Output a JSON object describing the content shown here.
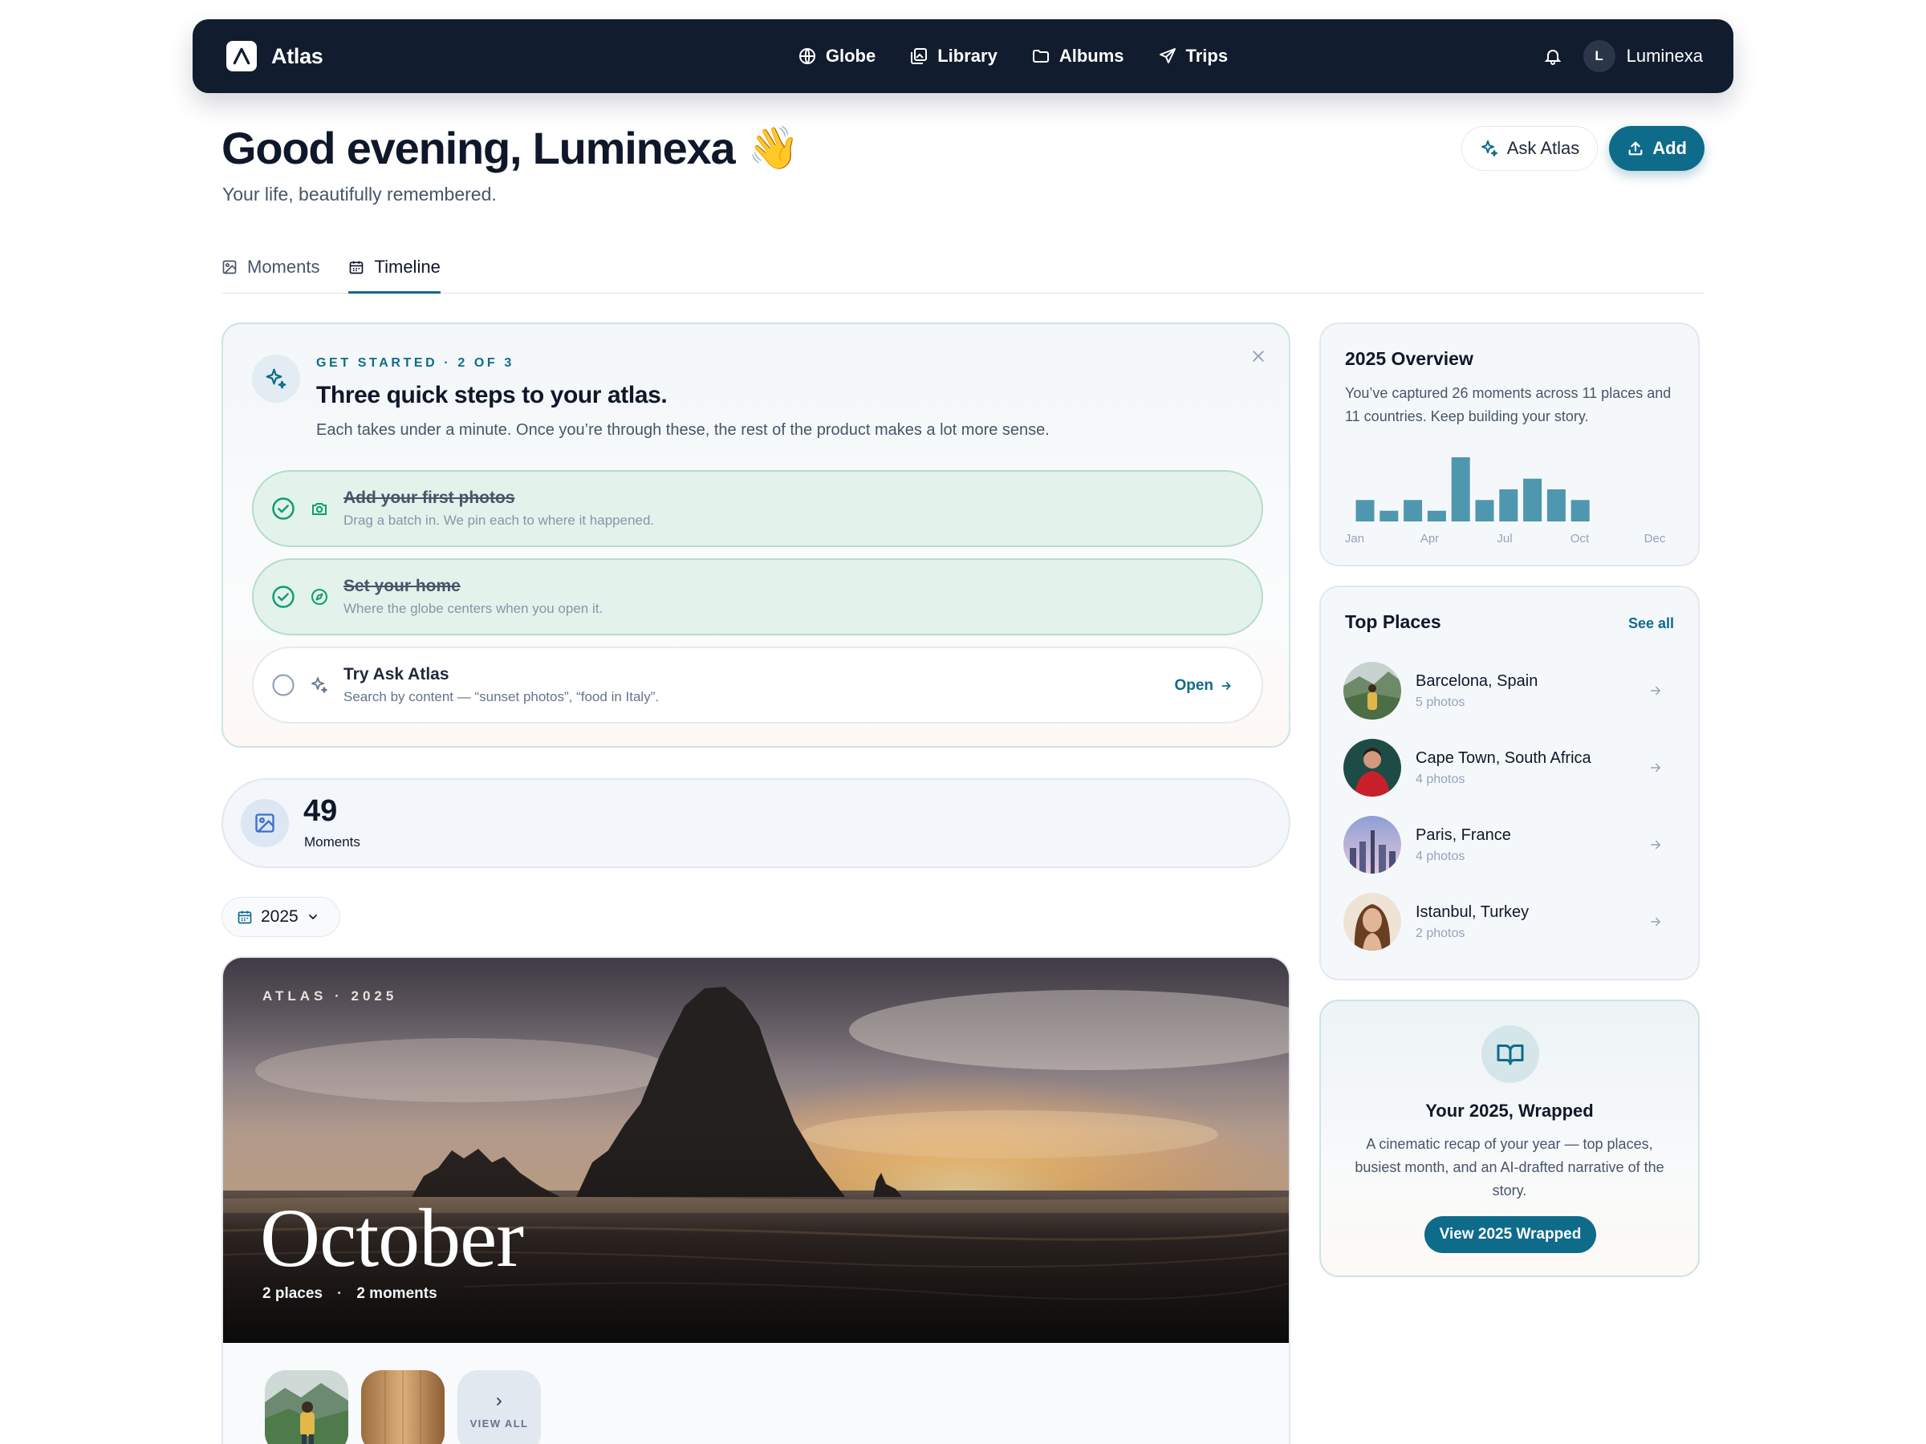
{
  "nav": {
    "brand": "Atlas",
    "links": [
      {
        "label": "Globe",
        "icon": "globe-icon"
      },
      {
        "label": "Library",
        "icon": "library-icon"
      },
      {
        "label": "Albums",
        "icon": "folder-icon"
      },
      {
        "label": "Trips",
        "icon": "send-icon"
      }
    ],
    "user_initial": "L",
    "user_name": "Luminexa"
  },
  "header": {
    "greeting": "Good evening, Luminexa",
    "emoji": "👋",
    "subtitle": "Your life, beautifully remembered.",
    "ask_label": "Ask Atlas",
    "add_label": "Add"
  },
  "tabs": [
    {
      "label": "Moments",
      "active": false
    },
    {
      "label": "Timeline",
      "active": true
    }
  ],
  "get_started": {
    "eyebrow": "GET STARTED · 2 OF 3",
    "title": "Three quick steps to your atlas.",
    "description": "Each takes under a minute. Once you’re through these, the rest of the product makes a lot more sense.",
    "steps": [
      {
        "title": "Add your first photos",
        "sub": "Drag a batch in. We pin each to where it happened.",
        "done": true
      },
      {
        "title": "Set your home",
        "sub": "Where the globe centers when you open it.",
        "done": true
      },
      {
        "title": "Try Ask Atlas",
        "sub": "Search by content — “sunset photos”, “food in Italy”.",
        "done": false,
        "action": "Open"
      }
    ]
  },
  "moments_stat": {
    "value": "49",
    "label": "Moments"
  },
  "year_select": {
    "value": "2025"
  },
  "month_card": {
    "eyebrow": "ATLAS · 2025",
    "month": "October",
    "places": "2 places",
    "separator": "·",
    "moments": "2 moments",
    "view_all": "VIEW ALL"
  },
  "overview": {
    "title": "2025 Overview",
    "description": "You’ve captured 26 moments across 11 places and 11 countries. Keep building your story.",
    "chart_data": {
      "type": "bar",
      "categories": [
        "Jan",
        "Feb",
        "Mar",
        "Apr",
        "May",
        "Jun",
        "Jul",
        "Aug",
        "Sep",
        "Oct",
        "Nov",
        "Dec"
      ],
      "values": [
        2,
        1,
        2,
        1,
        6,
        2,
        3,
        4,
        3,
        2,
        0,
        0
      ],
      "tick_labels": [
        "Jan",
        "Apr",
        "Jul",
        "Oct",
        "Dec"
      ],
      "color": "#4f97ae"
    }
  },
  "top_places": {
    "title": "Top Places",
    "see_all": "See all",
    "items": [
      {
        "name": "Barcelona, Spain",
        "count": "5 photos"
      },
      {
        "name": "Cape Town, South Africa",
        "count": "4 photos"
      },
      {
        "name": "Paris, France",
        "count": "4 photos"
      },
      {
        "name": "Istanbul, Turkey",
        "count": "2 photos"
      }
    ]
  },
  "wrapped": {
    "title": "Your 2025, Wrapped",
    "description": "A cinematic recap of your year — top places, busiest month, and an AI-drafted narrative of the story.",
    "button": "View 2025 Wrapped"
  },
  "colors": {
    "accent": "#0f6b8a",
    "nav_bg": "#111c2e",
    "done_bg": "#e3f3ec",
    "check": "#0e9f6e"
  }
}
